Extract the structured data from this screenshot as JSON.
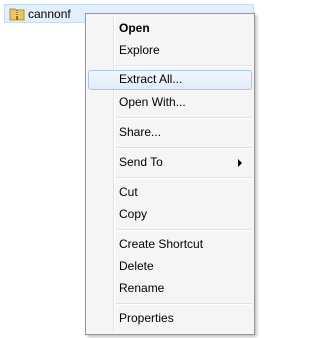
{
  "file": {
    "name": "cannonf",
    "icon": "zip-folder-icon"
  },
  "context_menu": {
    "items": [
      {
        "label": "Open",
        "bold": true
      },
      {
        "label": "Explore"
      },
      {
        "label": "Extract All...",
        "highlighted": true
      },
      {
        "label": "Open With..."
      },
      {
        "label": "Share..."
      },
      {
        "label": "Send To",
        "submenu": true
      },
      {
        "label": "Cut"
      },
      {
        "label": "Copy"
      },
      {
        "label": "Create Shortcut"
      },
      {
        "label": "Delete"
      },
      {
        "label": "Rename"
      },
      {
        "label": "Properties"
      }
    ]
  },
  "colors": {
    "selection_background": "#e3effc",
    "highlight_border": "#a9c6ee",
    "menu_background": "#f5f5f5",
    "menu_border": "#979797"
  }
}
